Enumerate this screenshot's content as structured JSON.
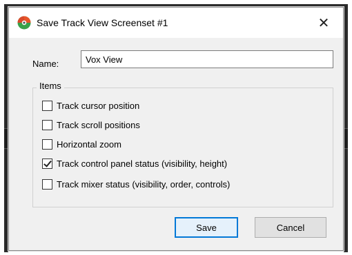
{
  "dialog": {
    "title": "Save Track View Screenset #1",
    "close_glyph": "✕",
    "app_icon": "reaper-logo-icon"
  },
  "name": {
    "label": "Name:",
    "value": "Vox View"
  },
  "items": {
    "group_label": "Items",
    "options": [
      {
        "label": "Track cursor position",
        "checked": false
      },
      {
        "label": "Track scroll positions",
        "checked": false
      },
      {
        "label": "Horizontal zoom",
        "checked": false
      },
      {
        "label": "Track control panel status (visibility, height)",
        "checked": true
      },
      {
        "label": "Track mixer status (visibility, order, controls)",
        "checked": false
      }
    ]
  },
  "buttons": {
    "save": "Save",
    "cancel": "Cancel"
  },
  "colors": {
    "accent": "#0078d7",
    "dialog_bg": "#f0f0f0"
  }
}
